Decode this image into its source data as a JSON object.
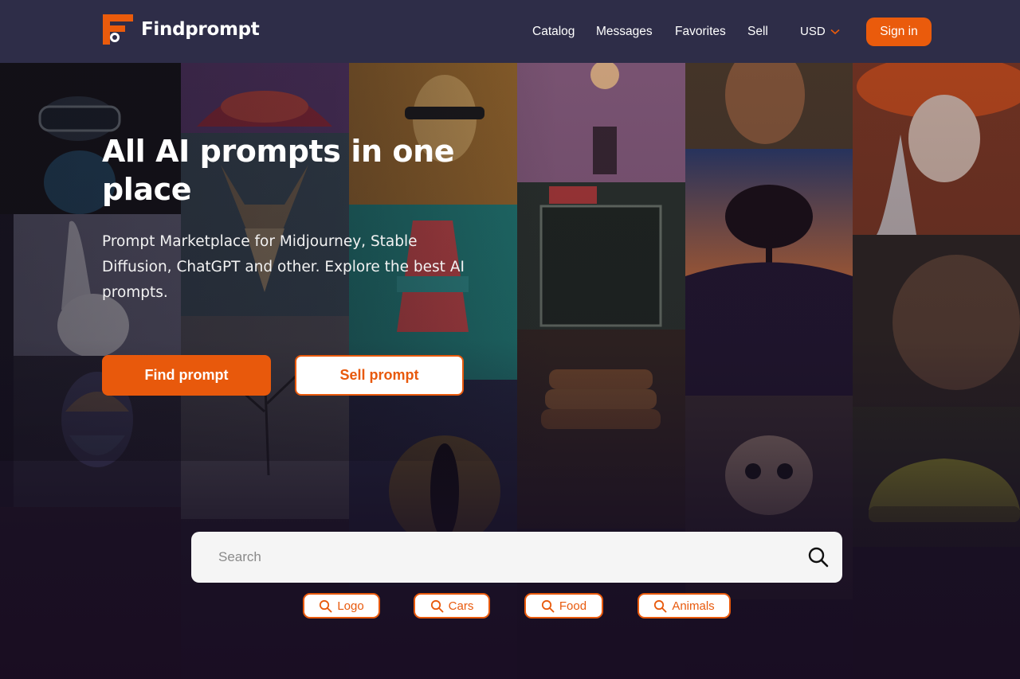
{
  "brand": {
    "name": "Findprompt",
    "accent": "#e8590c",
    "header_bg": "#2e2d48"
  },
  "nav": {
    "items": [
      {
        "label": "Catalog"
      },
      {
        "label": "Messages"
      },
      {
        "label": "Favorites"
      },
      {
        "label": "Sell"
      }
    ],
    "currency": "USD",
    "currency_icon": "chevron-down-icon",
    "signin_label": "Sign in"
  },
  "hero": {
    "title": "All AI prompts in one place",
    "subtitle": "Prompt Marketplace for Midjourney, Stable Diffusion, ChatGPT and other. Explore the best AI prompts.",
    "primary_button": "Find prompt",
    "secondary_button": "Sell prompt"
  },
  "search": {
    "placeholder": "Search",
    "icon": "search-icon",
    "tags": [
      {
        "label": "Logo"
      },
      {
        "label": "Cars"
      },
      {
        "label": "Food"
      },
      {
        "label": "Animals"
      }
    ]
  }
}
